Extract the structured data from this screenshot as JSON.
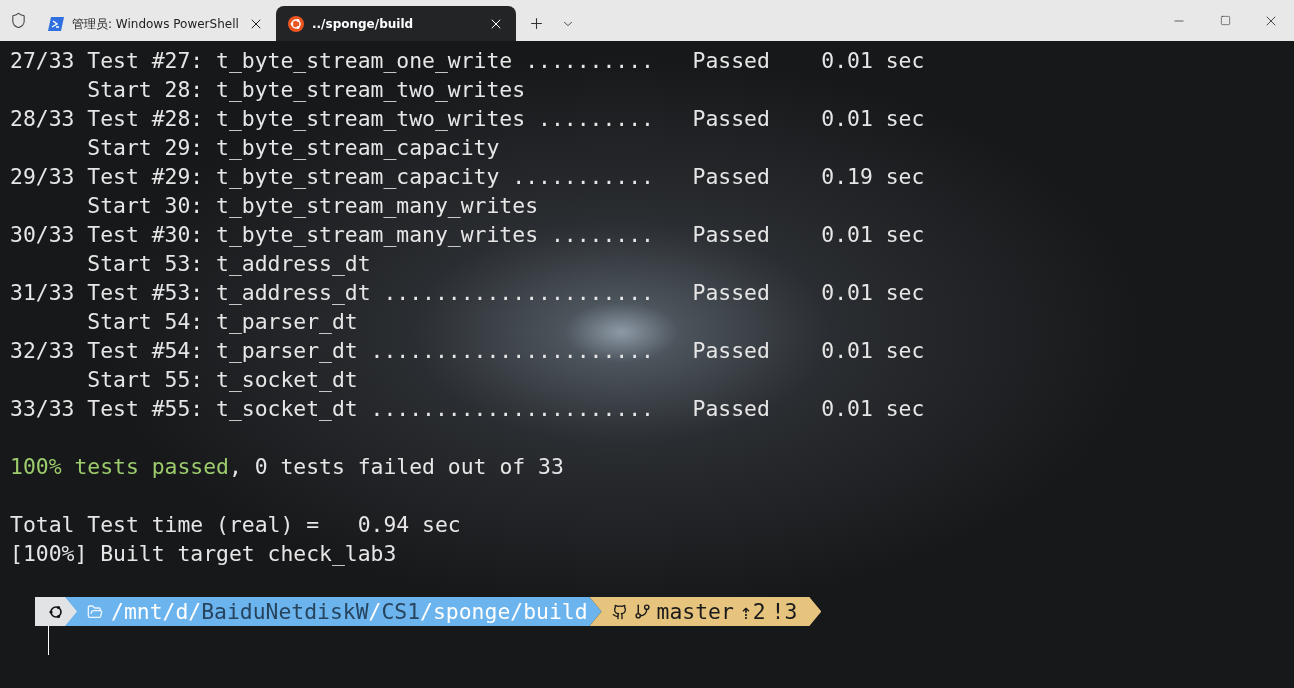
{
  "tabs": [
    {
      "kind": "powershell",
      "title": "管理员: Windows PowerShell",
      "selected": false
    },
    {
      "kind": "ubuntu",
      "title": "../sponge/build",
      "selected": true
    }
  ],
  "terminal": {
    "lines": [
      {
        "kind": "text",
        "text": "27/33 Test #27: t_byte_stream_one_write ..........   Passed    0.01 sec"
      },
      {
        "kind": "text",
        "text": "      Start 28: t_byte_stream_two_writes"
      },
      {
        "kind": "text",
        "text": "28/33 Test #28: t_byte_stream_two_writes .........   Passed    0.01 sec"
      },
      {
        "kind": "text",
        "text": "      Start 29: t_byte_stream_capacity"
      },
      {
        "kind": "text",
        "text": "29/33 Test #29: t_byte_stream_capacity ...........   Passed    0.19 sec"
      },
      {
        "kind": "text",
        "text": "      Start 30: t_byte_stream_many_writes"
      },
      {
        "kind": "text",
        "text": "30/33 Test #30: t_byte_stream_many_writes ........   Passed    0.01 sec"
      },
      {
        "kind": "text",
        "text": "      Start 53: t_address_dt"
      },
      {
        "kind": "text",
        "text": "31/33 Test #53: t_address_dt .....................   Passed    0.01 sec"
      },
      {
        "kind": "text",
        "text": "      Start 54: t_parser_dt"
      },
      {
        "kind": "text",
        "text": "32/33 Test #54: t_parser_dt ......................   Passed    0.01 sec"
      },
      {
        "kind": "text",
        "text": "      Start 55: t_socket_dt"
      },
      {
        "kind": "text",
        "text": "33/33 Test #55: t_socket_dt ......................   Passed    0.01 sec"
      },
      {
        "kind": "blank"
      },
      {
        "kind": "summary",
        "highlight": "100% tests passed",
        "text": ", 0 tests failed out of 33"
      },
      {
        "kind": "blank"
      },
      {
        "kind": "text",
        "text": "Total Test time (real) =   0.94 sec"
      },
      {
        "kind": "text",
        "text": "[100%] Built target check_lab3"
      },
      {
        "kind": "blank"
      }
    ],
    "prompt": {
      "path": [
        {
          "text": "/mnt/d/",
          "dim": false
        },
        {
          "text": "BaiduNetdiskW",
          "dim": true
        },
        {
          "text": "/",
          "dim": false
        },
        {
          "text": "CS1",
          "dim": true
        },
        {
          "text": "/sponge/build",
          "dim": false
        }
      ],
      "branch": "master",
      "ahead": "⇡2",
      "modified": "!3"
    }
  }
}
